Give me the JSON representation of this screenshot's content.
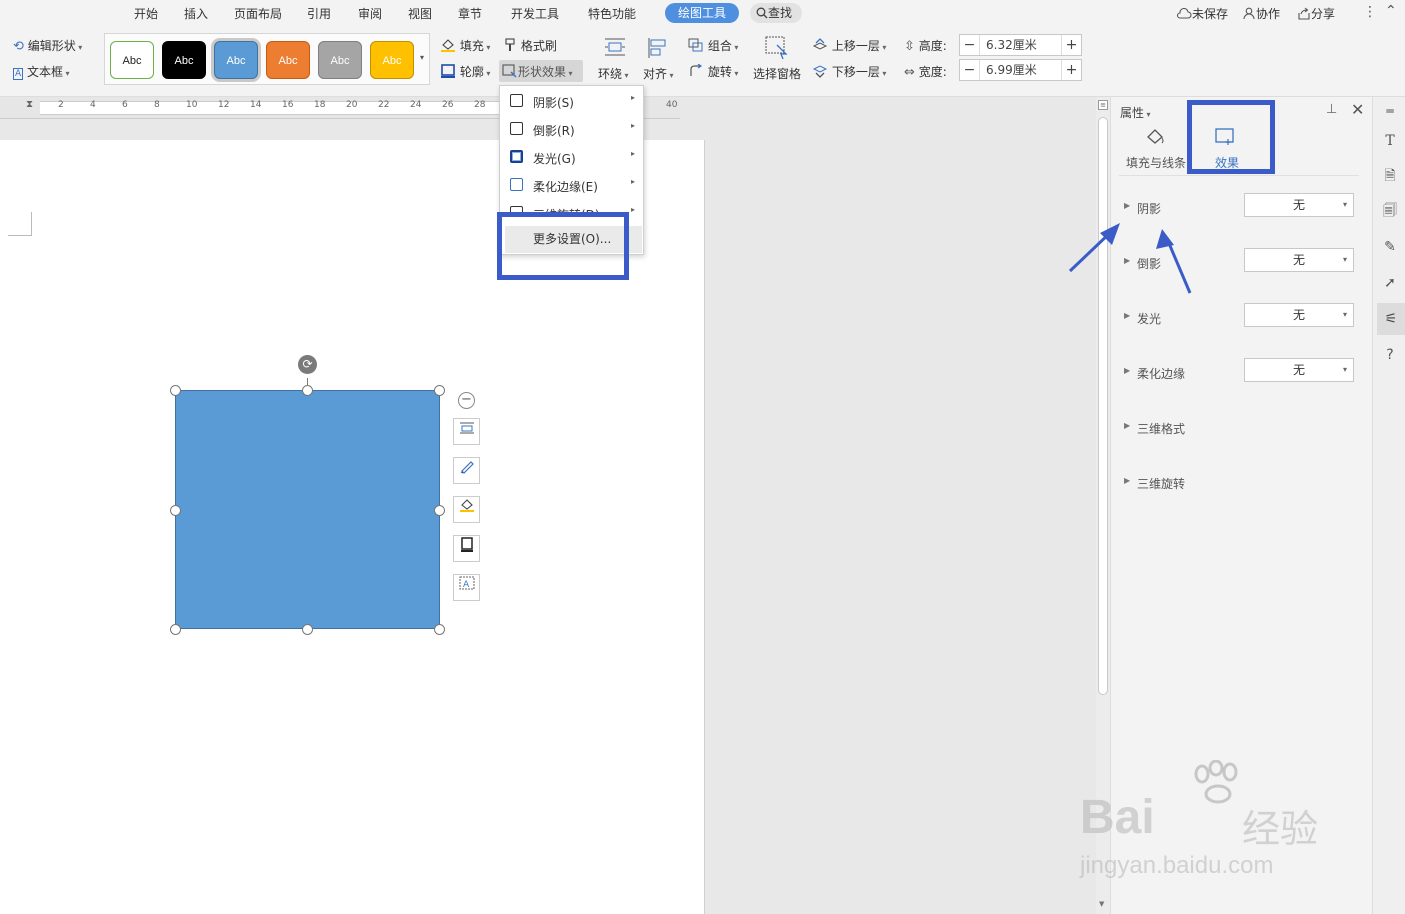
{
  "menubar": {
    "tabs": [
      "开始",
      "插入",
      "页面布局",
      "引用",
      "审阅",
      "视图",
      "章节",
      "开发工具",
      "特色功能"
    ],
    "active_tab": "绘图工具",
    "search_label": "查找",
    "unsaved_label": "未保存",
    "collab_label": "协作",
    "share_label": "分享"
  },
  "ribbon": {
    "edit_shape": "编辑形状",
    "text_box": "文本框",
    "style_swatches": [
      {
        "label": "Abc",
        "bg": "#ffffff",
        "fg": "#222222",
        "border": "#70ad47"
      },
      {
        "label": "Abc",
        "bg": "#000000",
        "fg": "#ffffff",
        "border": "#000000"
      },
      {
        "label": "Abc",
        "bg": "#5b9bd5",
        "fg": "#ffffff",
        "border": "#41719c"
      },
      {
        "label": "Abc",
        "bg": "#ed7d31",
        "fg": "#ffffff",
        "border": "#c55a11"
      },
      {
        "label": "Abc",
        "bg": "#a5a5a5",
        "fg": "#ffffff",
        "border": "#7f7f7f"
      },
      {
        "label": "Abc",
        "bg": "#ffc000",
        "fg": "#ffffff",
        "border": "#bf9000"
      }
    ],
    "fill": "填充",
    "format_painter": "格式刷",
    "outline": "轮廓",
    "shape_effects": "形状效果",
    "wrap": "环绕",
    "align": "对齐",
    "group": "组合",
    "rotate": "旋转",
    "selection_pane": "选择窗格",
    "bring_forward": "上移一层",
    "send_backward": "下移一层",
    "height_label": "高度:",
    "height_value": "6.32厘米",
    "width_label": "宽度:",
    "width_value": "6.99厘米"
  },
  "ruler": {
    "ticks": [
      "2",
      "4",
      "6",
      "8",
      "10",
      "12",
      "14",
      "16",
      "18",
      "20",
      "22",
      "24",
      "26",
      "28",
      "40"
    ]
  },
  "dropdown": {
    "items": [
      {
        "label": "阴影(S)"
      },
      {
        "label": "倒影(R)"
      },
      {
        "label": "发光(G)"
      },
      {
        "label": "柔化边缘(E)"
      },
      {
        "label": "三维旋转(D)"
      }
    ],
    "more_settings": "更多设置(O)..."
  },
  "panel": {
    "title": "属性",
    "tab_fill": "填充与线条",
    "tab_effects": "效果",
    "rows": [
      {
        "label": "阴影",
        "value": "无"
      },
      {
        "label": "倒影",
        "value": "无"
      },
      {
        "label": "发光",
        "value": "无"
      },
      {
        "label": "柔化边缘",
        "value": "无"
      },
      {
        "label": "三维格式",
        "value": ""
      },
      {
        "label": "三维旋转",
        "value": ""
      }
    ]
  },
  "watermark": {
    "brand": "Bai",
    "brand_cn": "经验",
    "url": "jingyan.baidu.com"
  },
  "colors": {
    "accent": "#4f8fe0",
    "shape_fill": "#5b9bd5",
    "highlight": "#3b5bc8"
  }
}
